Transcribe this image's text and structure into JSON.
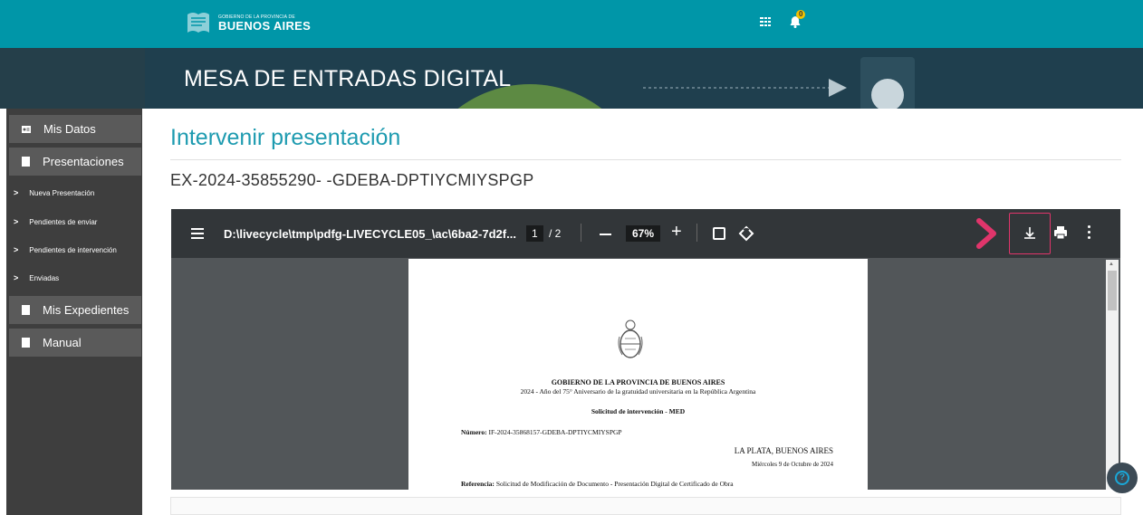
{
  "header": {
    "logo_small": "GOBIERNO DE LA PROVINCIA DE",
    "logo_big": "BUENOS AIRES",
    "notifications_count": "0",
    "grid_icon": "apps-grid-icon",
    "bell_icon": "bell-icon",
    "colors": {
      "topbar": "#0096a8",
      "badge": "#f2c200"
    }
  },
  "banner": {
    "title": "MESA DE ENTRADAS DIGITAL"
  },
  "sidebar": {
    "items": [
      {
        "label": "Mis Datos",
        "icon": "id-card-icon"
      },
      {
        "label": "Presentaciones",
        "icon": "document-icon"
      },
      {
        "label": "Mis Expedientes",
        "icon": "document-icon"
      },
      {
        "label": "Manual",
        "icon": "document-icon"
      }
    ],
    "subitems": [
      {
        "label": "Nueva Presentación"
      },
      {
        "label": "Pendientes de enviar"
      },
      {
        "label": "Pendientes de intervención"
      },
      {
        "label": "Enviadas"
      }
    ]
  },
  "main": {
    "title": "Intervenir presentación",
    "expediente": "EX-2024-35855290- -GDEBA-DPTIYCMIYSPGP",
    "accent_color": "#1e9bb0"
  },
  "viewer": {
    "file_name": "D:\\livecycle\\tmp\\pdfg-LIVECYCLE05_\\ac\\6ba2-7d2f...",
    "current_page": "1",
    "total_pages": "/ 2",
    "zoom": "67%",
    "zoom_minus": "—",
    "zoom_plus": "+",
    "icons": [
      "menu-icon",
      "fit-page-icon",
      "rotate-icon",
      "download-icon",
      "print-icon",
      "more-vert-icon"
    ],
    "highlight_color": "#e0356b"
  },
  "document": {
    "org": "GOBIERNO DE LA PROVINCIA DE BUENOS AIRES",
    "year_motto": "2024 - Año del 75° Aniversario de la gratuidad universitaria en la República Argentina",
    "subject": "Solicitud de intervención - MED",
    "numero_label": "Número:",
    "numero_value": "IF-2024-35868157-GDEBA-DPTIYCMIYSPGP",
    "place": "LA PLATA, BUENOS AIRES",
    "date": "Miércoles 9 de Octubre de 2024",
    "referencia_label": "Referencia:",
    "referencia_value": "Solicitud de Modificación de Documento - Presentación Digital de Certificado de Obra"
  },
  "help": {
    "icon": "help-icon",
    "label": "?"
  }
}
